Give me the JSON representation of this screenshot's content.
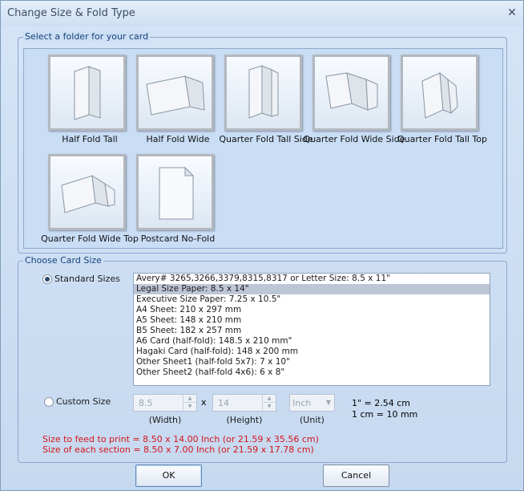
{
  "window": {
    "title": "Change Size & Fold Type",
    "close_symbol": "✕"
  },
  "folder_group": {
    "legend": "Select a folder for your card",
    "cards": [
      {
        "label": "Half Fold Tall",
        "icon": "half-fold-tall"
      },
      {
        "label": "Half Fold Wide",
        "icon": "half-fold-wide"
      },
      {
        "label": "Quarter Fold Tall Side",
        "icon": "quarter-fold-tall-side"
      },
      {
        "label": "Quarter Fold Wide Side",
        "icon": "quarter-fold-wide-side"
      },
      {
        "label": "Quarter Fold Tall Top",
        "icon": "quarter-fold-tall-top"
      },
      {
        "label": "Quarter Fold Wide Top",
        "icon": "quarter-fold-wide-top"
      },
      {
        "label": "Postcard No-Fold",
        "icon": "postcard-no-fold"
      }
    ]
  },
  "size_group": {
    "legend": "Choose Card Size",
    "standard": {
      "label": "Standard Sizes",
      "checked": true,
      "items": [
        "Avery# 3265,3266,3379,8315,8317 or Letter Size: 8.5 x 11\"",
        "Legal Size Paper: 8.5 x 14\"",
        "Executive Size Paper: 7.25 x 10.5\"",
        "A4 Sheet: 210 x 297 mm",
        "A5 Sheet: 148 x 210 mm",
        "B5 Sheet: 182 x 257 mm",
        "A6 Card (half-fold): 148.5 x 210 mm\"",
        "Hagaki Card (half-fold): 148 x 200 mm",
        "Other Sheet1 (half-fold 5x7): 7 x 10\"",
        "Other Sheet2 (half-fold 4x6): 6 x 8\""
      ],
      "selected_index": 1
    },
    "custom": {
      "label": "Custom Size",
      "checked": false,
      "width_value": "8.5",
      "height_value": "14",
      "times": "x",
      "width_label": "(Width)",
      "height_label": "(Height)",
      "unit_value": "Inch",
      "unit_label": "(Unit)",
      "conv_inch": "1\"  = 2.54 cm",
      "conv_cm": "1 cm = 10 mm"
    },
    "feed_text": "Size to feed to print = 8.50 x 14.00 Inch (or  21.59 x 35.56 cm)",
    "section_text": "Size of each section = 8.50 x 7.00 Inch (or  21.59 x 17.78 cm)"
  },
  "buttons": {
    "ok": "OK",
    "cancel": "Cancel"
  },
  "colors": {
    "accent": "#16407a",
    "warning": "#d4141a",
    "selection": "#bcc6d6"
  }
}
